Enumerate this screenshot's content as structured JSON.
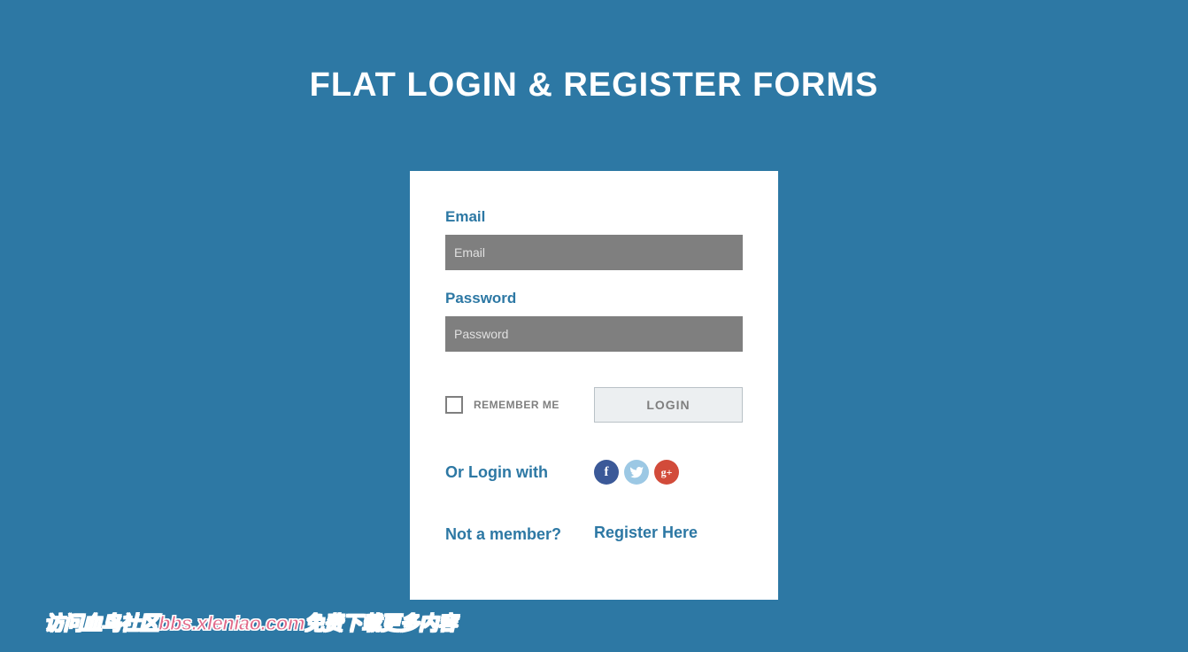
{
  "pageTitle": "FLAT LOGIN & REGISTER FORMS",
  "form": {
    "emailLabel": "Email",
    "emailPlaceholder": "Email",
    "passwordLabel": "Password",
    "passwordPlaceholder": "Password",
    "rememberLabel": "REMEMBER ME",
    "loginButton": "LOGIN",
    "orLoginWith": "Or Login with",
    "notMember": "Not a member?",
    "registerHere": "Register Here"
  },
  "watermark": "访问血鸟社区bbs.xleniao.com免费下载更多内容"
}
